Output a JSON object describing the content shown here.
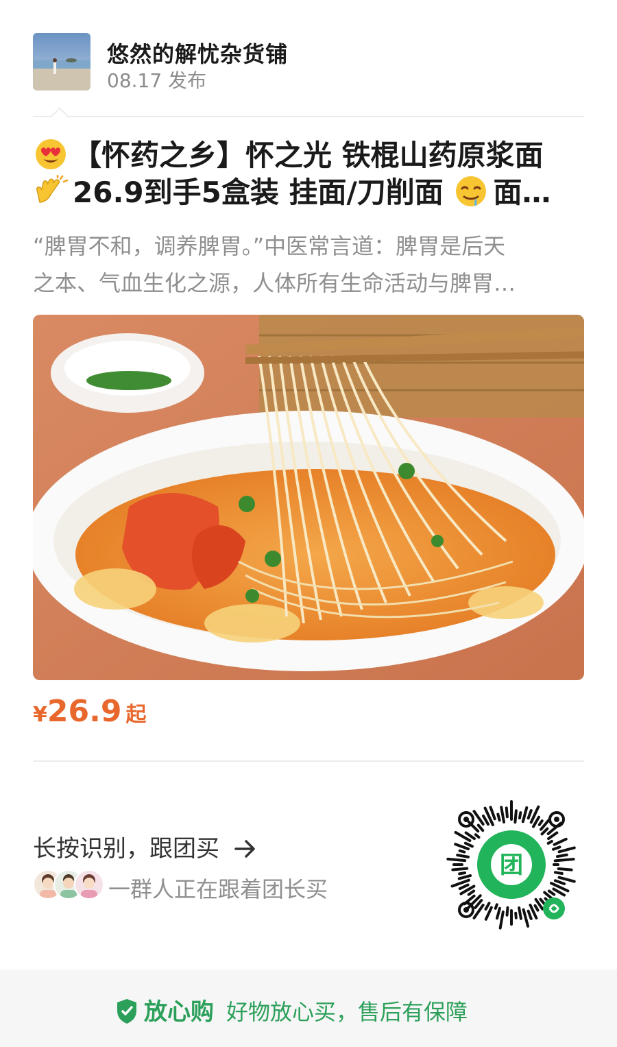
{
  "post": {
    "shop_name": "悠然的解忧杂货铺",
    "date": "08.17 发布"
  },
  "product": {
    "title_line1": "【怀药之乡】怀之光 铁棍山药原浆面",
    "title_line2_a": "26.9到手5盒装 挂面/刀削面 ",
    "title_line2_b": "面…",
    "desc_line1": "“脾胃不和，调养脾胃。”中医常言道：脾胃是后天",
    "desc_line2": "之本、气血生化之源，人体所有生命活动与脾胃…",
    "price_symbol": "¥",
    "price_value": "26.9",
    "price_suffix": "起"
  },
  "cta": {
    "label": "长按识别，跟团买",
    "social": "一群人正在跟着团长买"
  },
  "footer": {
    "brand": "放心购",
    "text": "好物放心买，售后有保障"
  },
  "colors": {
    "price": "#e8672c",
    "assure_green": "#2ca05a",
    "qr_green": "#21b45a"
  },
  "icons": {
    "title_emoji_1": "heart-eyes-emoji-icon",
    "title_emoji_2": "clapping-hands-emoji-icon",
    "title_emoji_3": "drooling-face-emoji-icon",
    "cta_arrow": "arrow-right-icon",
    "footer_shield": "shield-check-icon"
  }
}
